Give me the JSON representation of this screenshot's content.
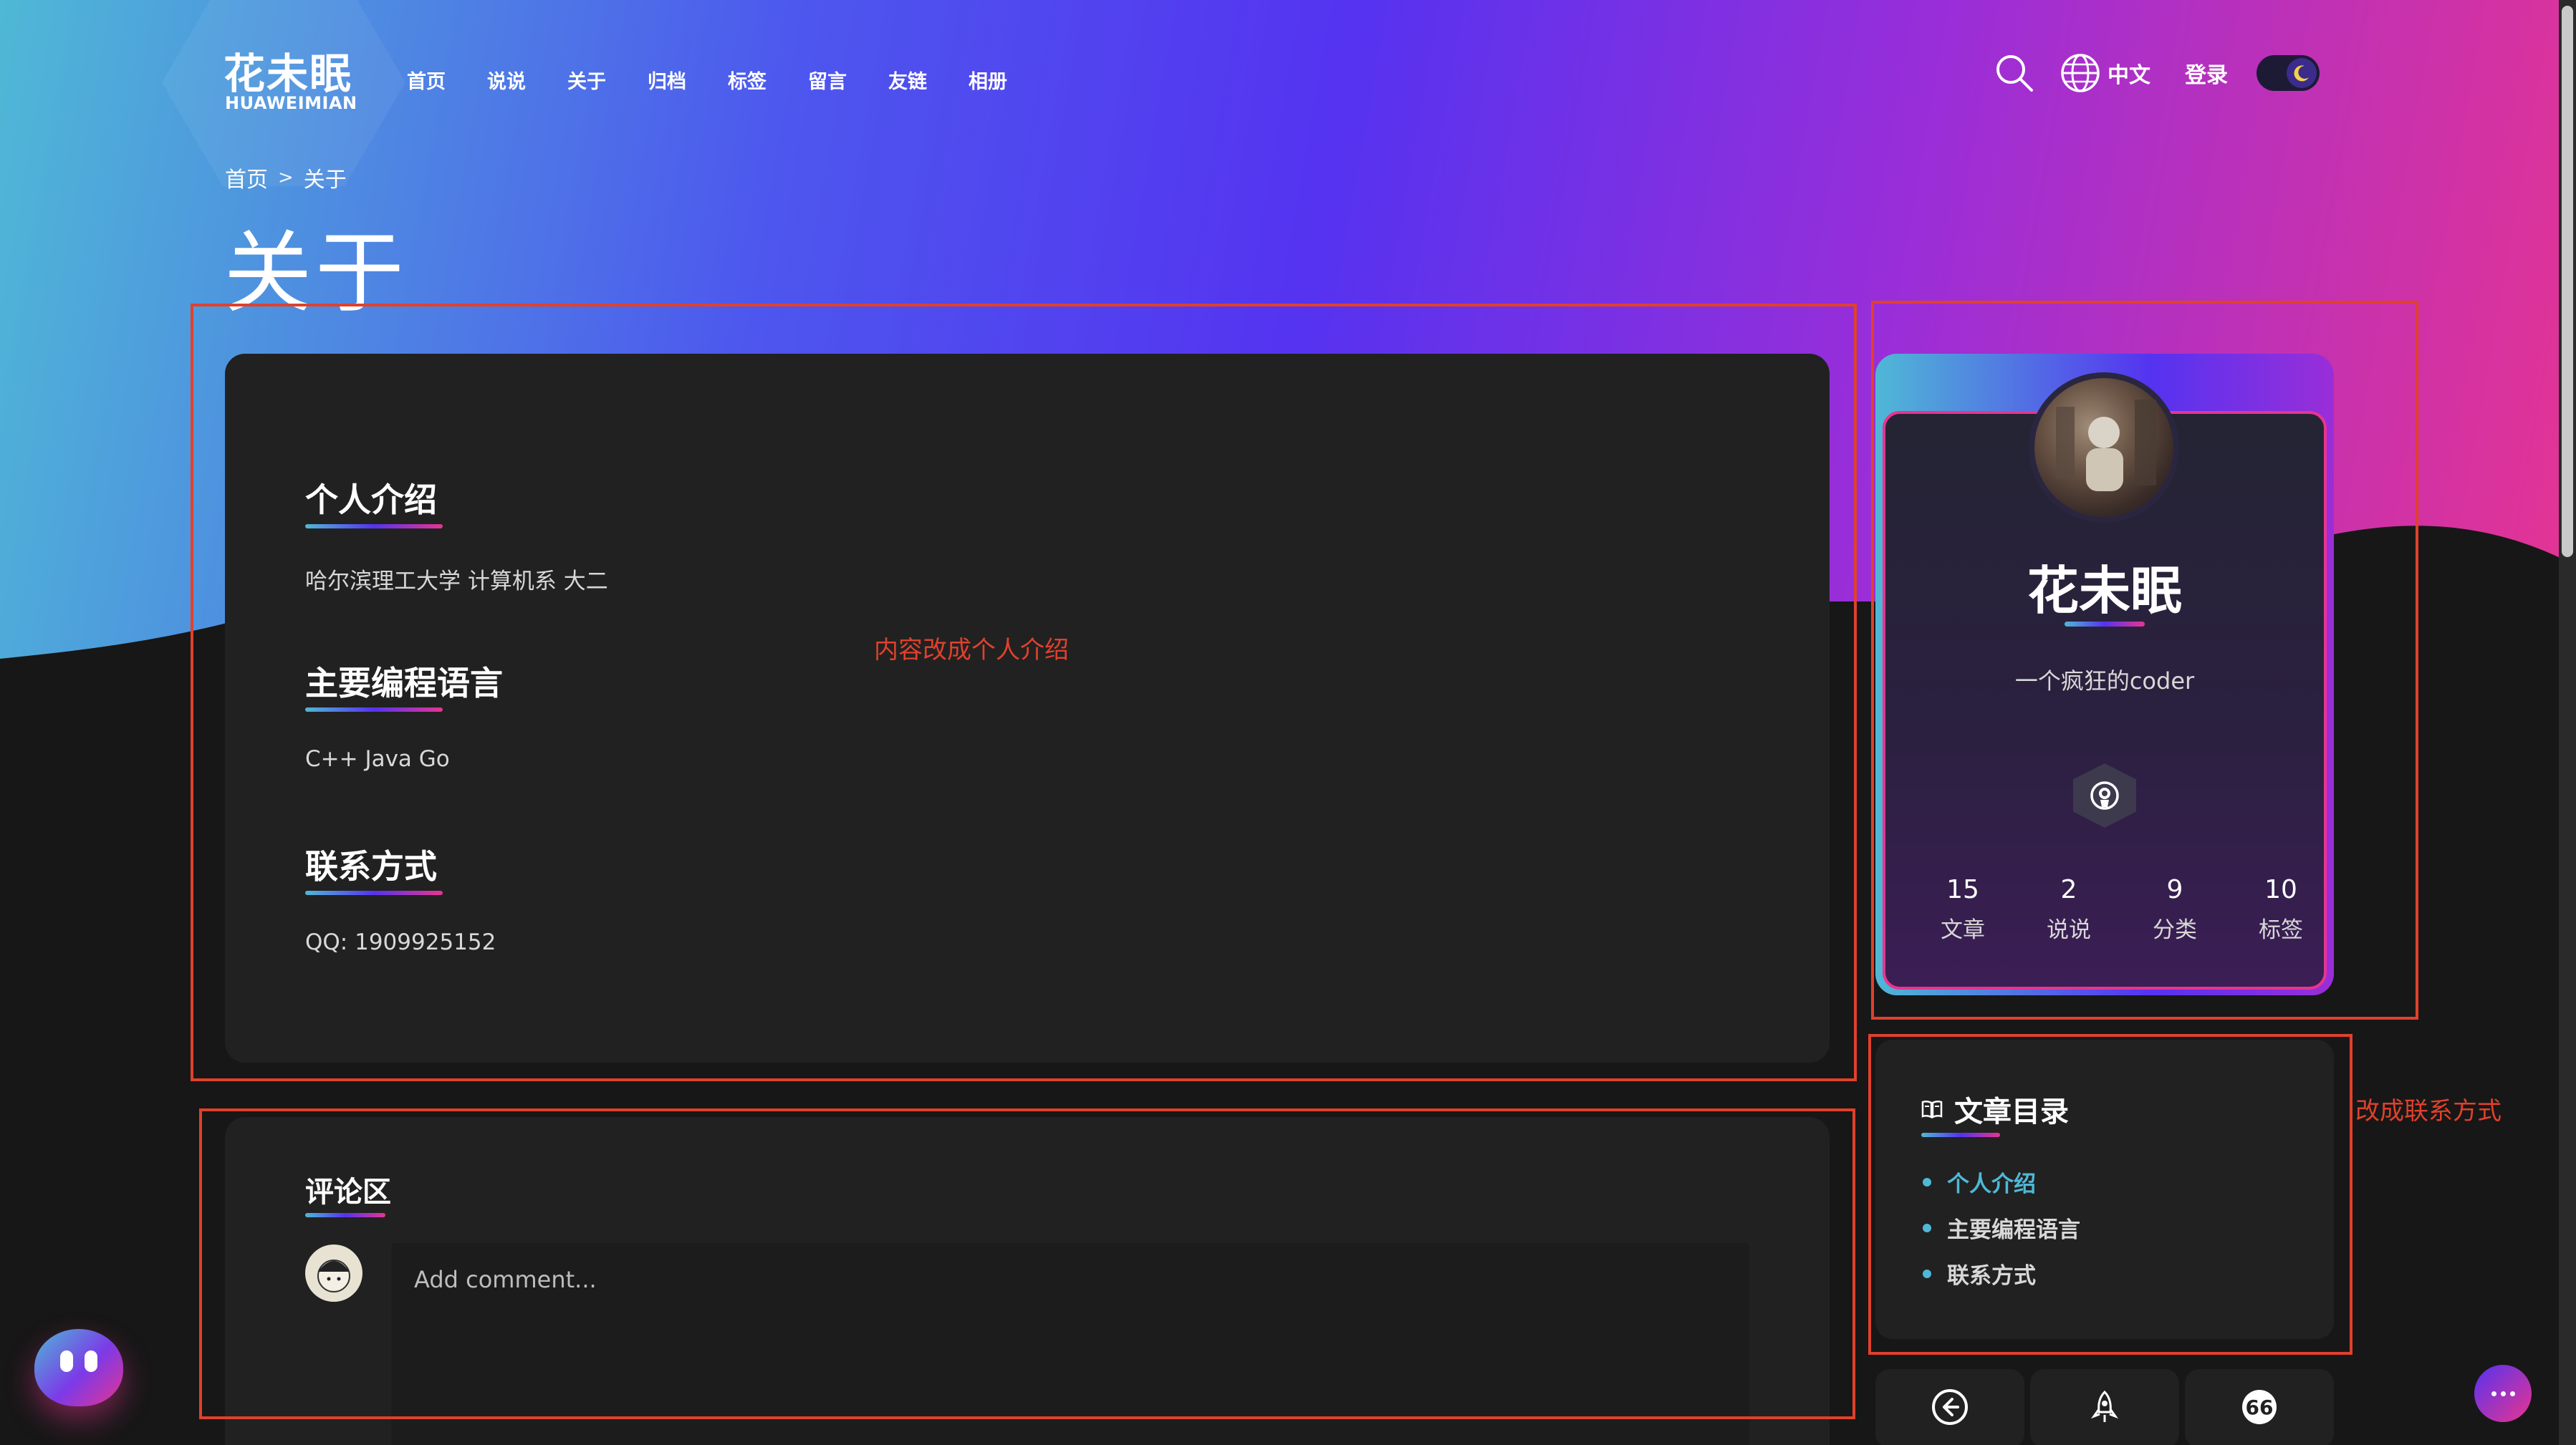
{
  "site": {
    "title": "花未眠",
    "subtitle": "HUAWEIMIAN"
  },
  "nav": [
    "首页",
    "说说",
    "关于",
    "归档",
    "标签",
    "留言",
    "友链",
    "相册"
  ],
  "header": {
    "lang_label": "中文",
    "login_label": "登录"
  },
  "breadcrumb": {
    "home": "首页",
    "sep": ">",
    "current": "关于"
  },
  "page_title": "关于",
  "about": {
    "sections": [
      {
        "heading": "个人介绍",
        "text": "哈尔滨理工大学 计算机系 大二"
      },
      {
        "heading": "主要编程语言",
        "text": "C++ Java Go"
      },
      {
        "heading": "联系方式",
        "text": "QQ: 1909925152"
      }
    ]
  },
  "annotations": {
    "main_note": "内容改成个人介绍",
    "toc_note": "改成联系方式"
  },
  "comments": {
    "heading": "评论区",
    "placeholder": "Add comment..."
  },
  "profile": {
    "name": "花未眠",
    "bio": "一个疯狂的coder",
    "stats": [
      {
        "value": "15",
        "label": "文章"
      },
      {
        "value": "2",
        "label": "说说"
      },
      {
        "value": "9",
        "label": "分类"
      },
      {
        "value": "10",
        "label": "标签"
      }
    ]
  },
  "toc": {
    "title": "文章目录",
    "items": [
      {
        "label": "个人介绍",
        "active": true
      },
      {
        "label": "主要编程语言",
        "active": false
      },
      {
        "label": "联系方式",
        "active": false
      }
    ]
  },
  "colors": {
    "accent_cyan": "#4fb8d6",
    "accent_purple": "#5533f0",
    "accent_pink": "#e8348f",
    "annotation_red": "#e0412c"
  },
  "icons": [
    "search-icon",
    "globe-icon",
    "moon-icon",
    "github-icon",
    "book-icon",
    "arrow-left-icon",
    "rocket-icon",
    "quote-icon",
    "robot-icon",
    "chat-icon"
  ]
}
